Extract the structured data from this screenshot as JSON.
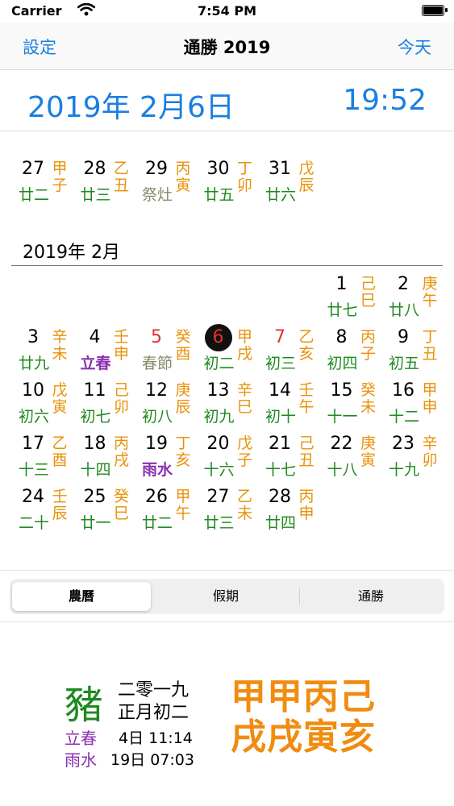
{
  "status_bar": {
    "carrier": "Carrier",
    "time": "7:54 PM"
  },
  "nav": {
    "left_button": "設定",
    "title": "通勝 2019",
    "right_button": "今天"
  },
  "date_bar": {
    "date": "2019年 2月6日",
    "time": "19:52"
  },
  "calendar": {
    "prev_rows": [
      [
        {
          "num": "27",
          "lunar": "廿二",
          "gz": "甲子"
        },
        {
          "num": "28",
          "lunar": "廿三",
          "gz": "乙丑"
        },
        {
          "num": "29",
          "lunar": "祭灶",
          "gz": "丙寅",
          "lunar_style": "holiday"
        },
        {
          "num": "30",
          "lunar": "廿五",
          "gz": "丁卯"
        },
        {
          "num": "31",
          "lunar": "廿六",
          "gz": "戊辰"
        }
      ]
    ],
    "month_title": "2019年 2月",
    "weeks": [
      [
        {
          "col": 5,
          "num": "1",
          "lunar": "廿七",
          "gz": "己巳"
        },
        {
          "col": 6,
          "num": "2",
          "lunar": "廿八",
          "gz": "庚午"
        }
      ],
      [
        {
          "col": 0,
          "num": "3",
          "lunar": "廿九",
          "gz": "辛未"
        },
        {
          "col": 1,
          "num": "4",
          "lunar": "立春",
          "gz": "壬申",
          "lunar_style": "term"
        },
        {
          "col": 2,
          "num": "5",
          "lunar": "春節",
          "gz": "癸酉",
          "num_style": "red",
          "lunar_style": "holiday"
        },
        {
          "col": 3,
          "num": "6",
          "lunar": "初二",
          "gz": "甲戌",
          "num_style": "today"
        },
        {
          "col": 4,
          "num": "7",
          "lunar": "初三",
          "gz": "乙亥",
          "num_style": "red"
        },
        {
          "col": 5,
          "num": "8",
          "lunar": "初四",
          "gz": "丙子"
        },
        {
          "col": 6,
          "num": "9",
          "lunar": "初五",
          "gz": "丁丑"
        }
      ],
      [
        {
          "col": 0,
          "num": "10",
          "lunar": "初六",
          "gz": "戊寅"
        },
        {
          "col": 1,
          "num": "11",
          "lunar": "初七",
          "gz": "己卯"
        },
        {
          "col": 2,
          "num": "12",
          "lunar": "初八",
          "gz": "庚辰"
        },
        {
          "col": 3,
          "num": "13",
          "lunar": "初九",
          "gz": "辛巳"
        },
        {
          "col": 4,
          "num": "14",
          "lunar": "初十",
          "gz": "壬午"
        },
        {
          "col": 5,
          "num": "15",
          "lunar": "十一",
          "gz": "癸未"
        },
        {
          "col": 6,
          "num": "16",
          "lunar": "十二",
          "gz": "甲申"
        }
      ],
      [
        {
          "col": 0,
          "num": "17",
          "lunar": "十三",
          "gz": "乙酉"
        },
        {
          "col": 1,
          "num": "18",
          "lunar": "十四",
          "gz": "丙戌"
        },
        {
          "col": 2,
          "num": "19",
          "lunar": "雨水",
          "gz": "丁亥",
          "lunar_style": "term"
        },
        {
          "col": 3,
          "num": "20",
          "lunar": "十六",
          "gz": "戊子"
        },
        {
          "col": 4,
          "num": "21",
          "lunar": "十七",
          "gz": "己丑"
        },
        {
          "col": 5,
          "num": "22",
          "lunar": "十八",
          "gz": "庚寅"
        },
        {
          "col": 6,
          "num": "23",
          "lunar": "十九",
          "gz": "辛卯"
        }
      ],
      [
        {
          "col": 0,
          "num": "24",
          "lunar": "二十",
          "gz": "壬辰"
        },
        {
          "col": 1,
          "num": "25",
          "lunar": "廿一",
          "gz": "癸巳"
        },
        {
          "col": 2,
          "num": "26",
          "lunar": "廿二",
          "gz": "甲午"
        },
        {
          "col": 3,
          "num": "27",
          "lunar": "廿三",
          "gz": "乙未"
        },
        {
          "col": 4,
          "num": "28",
          "lunar": "廿四",
          "gz": "丙申"
        }
      ]
    ]
  },
  "segments": {
    "items": [
      "農曆",
      "假期",
      "通勝"
    ],
    "selected": "農曆"
  },
  "info": {
    "zodiac": "豬",
    "lunar_year": "二零一九",
    "lunar_month_day": "正月初二",
    "term1_name": "立春",
    "term1_time": "4日 11:14",
    "term2_name": "雨水",
    "term2_time": "19日 07:03",
    "pillars_line1": "甲甲丙己",
    "pillars_line2": "戌戌寅亥"
  }
}
